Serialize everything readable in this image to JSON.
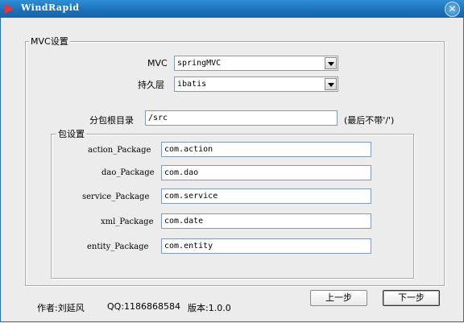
{
  "window": {
    "title": "WindRapid",
    "close_symbol": "✕"
  },
  "mvc_group": {
    "legend": "MVC设置",
    "mvc_label": "MVC",
    "mvc_value": "springMVC",
    "persistence_label": "持久层",
    "persistence_value": "ibatis",
    "root_dir_label": "分包根目录",
    "root_dir_value": "/src",
    "root_dir_hint": "(最后不带'/')"
  },
  "package_group": {
    "legend": "包设置",
    "fields": [
      {
        "label": "action_Package",
        "value": "com.action"
      },
      {
        "label": "dao_Package",
        "value": "com.dao"
      },
      {
        "label": "service_Package",
        "value": "com.service"
      },
      {
        "label": "xml_Package",
        "value": "com.date"
      },
      {
        "label": "entity_Package",
        "value": "com.entity"
      }
    ]
  },
  "footer": {
    "author": "作者:刘延风",
    "qq": "QQ:1186868584",
    "version": "版本:1.0.0"
  },
  "buttons": {
    "prev": "上一步",
    "next": "下一步"
  }
}
